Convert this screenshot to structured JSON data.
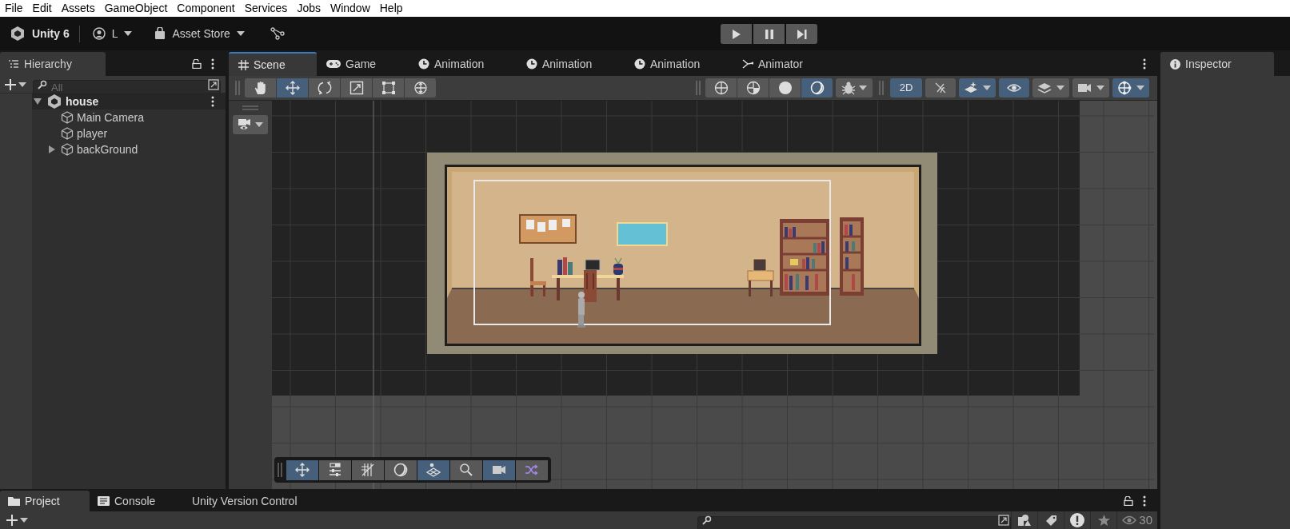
{
  "menu": [
    "File",
    "Edit",
    "Assets",
    "GameObject",
    "Component",
    "Services",
    "Jobs",
    "Window",
    "Help"
  ],
  "toolbar": {
    "product": "Unity 6",
    "account": "L",
    "asset_store": "Asset Store"
  },
  "hierarchy": {
    "title": "Hierarchy",
    "search": {
      "placeholder": "All"
    },
    "items": [
      {
        "label": "house",
        "kind": "scene",
        "expanded": true,
        "children": [
          {
            "label": "Main Camera",
            "kind": "object"
          },
          {
            "label": "player",
            "kind": "object"
          },
          {
            "label": "backGround",
            "kind": "object",
            "expanded": false
          }
        ]
      }
    ]
  },
  "center_tabs": [
    {
      "label": "Scene",
      "kind": "scene",
      "selected": true
    },
    {
      "label": "Game",
      "kind": "game",
      "selected": false
    },
    {
      "label": "Animation",
      "kind": "animation",
      "selected": false
    },
    {
      "label": "Animation",
      "kind": "animation",
      "selected": false
    },
    {
      "label": "Animation",
      "kind": "animation",
      "selected": false
    },
    {
      "label": "Animator",
      "kind": "animator",
      "selected": false
    }
  ],
  "scene_tools": [
    {
      "kind": "hand",
      "selected": false
    },
    {
      "kind": "move",
      "selected": true
    },
    {
      "kind": "rotate",
      "selected": false
    },
    {
      "kind": "scale",
      "selected": false
    },
    {
      "kind": "rect",
      "selected": false
    },
    {
      "kind": "transform",
      "selected": false
    }
  ],
  "draw_modes": [
    {
      "kind": "wireframe",
      "selected": false
    },
    {
      "kind": "shaded-wireframe",
      "selected": false
    },
    {
      "kind": "shaded",
      "selected": false
    },
    {
      "kind": "unlit",
      "selected": true
    }
  ],
  "view_options": [
    {
      "kind": "dimension",
      "label": "2D",
      "selected": true
    },
    {
      "kind": "lighting",
      "selected": false
    },
    {
      "kind": "effects",
      "selected": true
    },
    {
      "kind": "visibility",
      "selected": true
    },
    {
      "kind": "layers",
      "selected": false
    },
    {
      "kind": "camera",
      "selected": false
    },
    {
      "kind": "gizmos",
      "selected": true
    }
  ],
  "overlay_tools": [
    {
      "kind": "move",
      "selected": true
    },
    {
      "kind": "sliders",
      "selected": false
    },
    {
      "kind": "grid",
      "selected": false
    },
    {
      "kind": "moon",
      "selected": false
    },
    {
      "kind": "plane",
      "selected": true
    },
    {
      "kind": "search",
      "selected": false
    },
    {
      "kind": "camera",
      "selected": true
    },
    {
      "kind": "shuffle",
      "selected": false
    }
  ],
  "inspector": {
    "title": "Inspector"
  },
  "bottom_tabs": [
    {
      "label": "Project",
      "kind": "folder",
      "selected": true
    },
    {
      "label": "Console",
      "kind": "console",
      "selected": false
    },
    {
      "label": "Unity Version Control",
      "kind": "none",
      "selected": false
    }
  ],
  "project_bar": {
    "hidden_count": "30"
  }
}
